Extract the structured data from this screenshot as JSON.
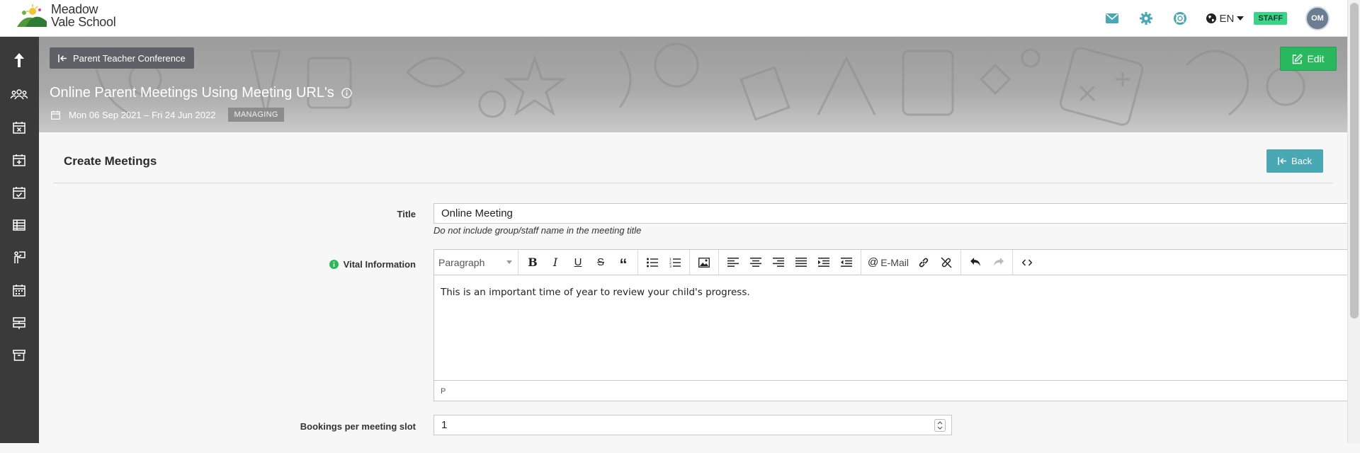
{
  "app": {
    "school_name_line1": "Meadow",
    "school_name_line2": "Vale School",
    "language": "EN",
    "role_badge": "STAFF",
    "user_initials": "OM"
  },
  "topbar_icons": [
    "envelope-icon",
    "gear-icon",
    "lifebuoy-icon",
    "globe-icon"
  ],
  "sidebar_icons": [
    "upload-arrow-icon",
    "users-icon",
    "calendar-x-icon",
    "calendar-plus-icon",
    "calendar-check-icon",
    "table-icon",
    "presenter-icon",
    "calendar-icon",
    "signpost-icon",
    "archive-icon"
  ],
  "banner": {
    "breadcrumb_label": "Parent Teacher Conference",
    "edit_label": "Edit",
    "title": "Online Parent Meetings Using Meeting URL's",
    "date_range": "Mon 06 Sep 2021 – Fri 24 Jun 2022",
    "status": "MANAGING"
  },
  "form": {
    "heading": "Create Meetings",
    "back_label": "Back",
    "title_label": "Title",
    "title_value": "Online Meeting",
    "title_help": "Do not include group/staff name in the meeting title",
    "vital_label": "Vital Information",
    "editor": {
      "format_select": "Paragraph",
      "email_label": "E-Mail",
      "content": "This is an important time of year to review your child's progress.",
      "status_path": "P"
    },
    "bookings_label": "Bookings per meeting slot",
    "bookings_value": "1"
  },
  "colors": {
    "accent_teal": "#4aa8b5",
    "edit_green": "#2ab85e",
    "staff_badge": "#39d487",
    "sidebar_bg": "#3a3a3a"
  }
}
